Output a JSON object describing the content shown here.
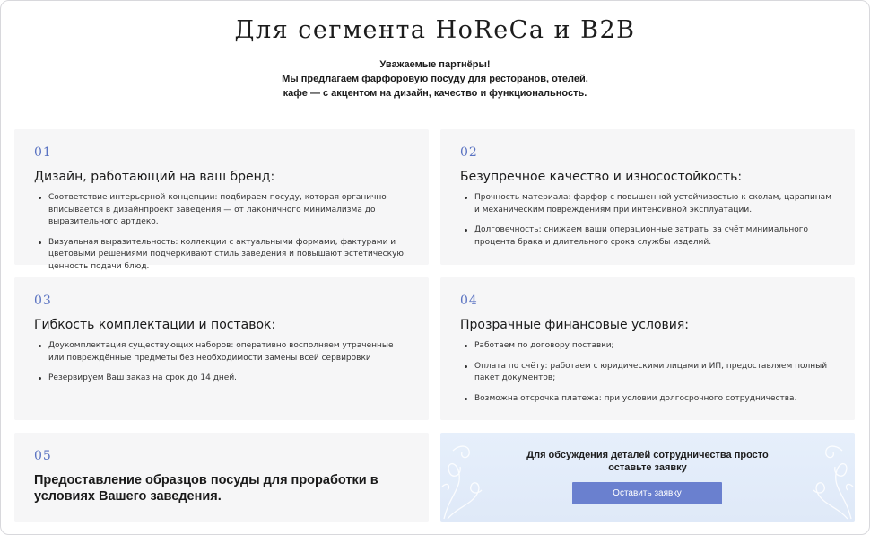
{
  "header": {
    "title": "Для сегмента HoReCa и B2B",
    "intro_line1": "Уважаемые партнёры!",
    "intro_line2": "Мы предлагаем фарфоровую посуду для ресторанов, отелей,",
    "intro_line3": "кафе — с акцентом на дизайн, качество и функциональность."
  },
  "cards": [
    {
      "num": "01",
      "title": "Дизайн, работающий на ваш бренд:",
      "bullets": [
        "Соответствие интерьерной концепции: подбираем посуду, которая органично вписывается в дизайнпроект заведения — от лаконичного минимализма до выразительного артдеко.",
        "Визуальная выразительность: коллекции с актуальными формами, фактурами и цветовыми решениями подчёркивают стиль заведения и повышают эстетическую ценность подачи блюд."
      ]
    },
    {
      "num": "02",
      "title": "Безупречное качество и износостойкость:",
      "bullets": [
        "Прочность материала: фарфор с повышенной устойчивостью к сколам, царапинам и механическим повреждениям при интенсивной эксплуатации.",
        "Долговечность: снижаем ваши операционные затраты за счёт минимального процента брака и длительного срока службы изделий."
      ]
    },
    {
      "num": "03",
      "title": "Гибкость комплектации и поставок:",
      "bullets": [
        "Доукомплектация существующих наборов: оперативно восполняем утраченные или повреждённые предметы без необходимости замены всей сервировки",
        "Резервируем Ваш заказ на срок до 14 дней."
      ]
    },
    {
      "num": "04",
      "title": "Прозрачные финансовые условия:",
      "bullets": [
        "Работаем по договору поставки;",
        "Оплата по счёту: работаем с юридическими лицами и ИП, предоставляем полный пакет документов;",
        "Возможна отсрочка платежа: при условии долгосрочного сотрудничества."
      ]
    },
    {
      "num": "05",
      "title": "Предоставление образцов посуды для проработки в условиях Вашего заведения."
    }
  ],
  "cta": {
    "text_line1": "Для обсуждения деталей сотрудничества просто",
    "text_line2": "оставьте заявку",
    "button_label": "Оставить заявку"
  },
  "colors": {
    "accent": "#5a73c2",
    "button": "#6a80cf",
    "card_bg": "#f6f6f7",
    "cta_bg": "#e3ecfa"
  },
  "icons": [
    "floral-ornament-left-icon",
    "floral-ornament-right-icon"
  ]
}
